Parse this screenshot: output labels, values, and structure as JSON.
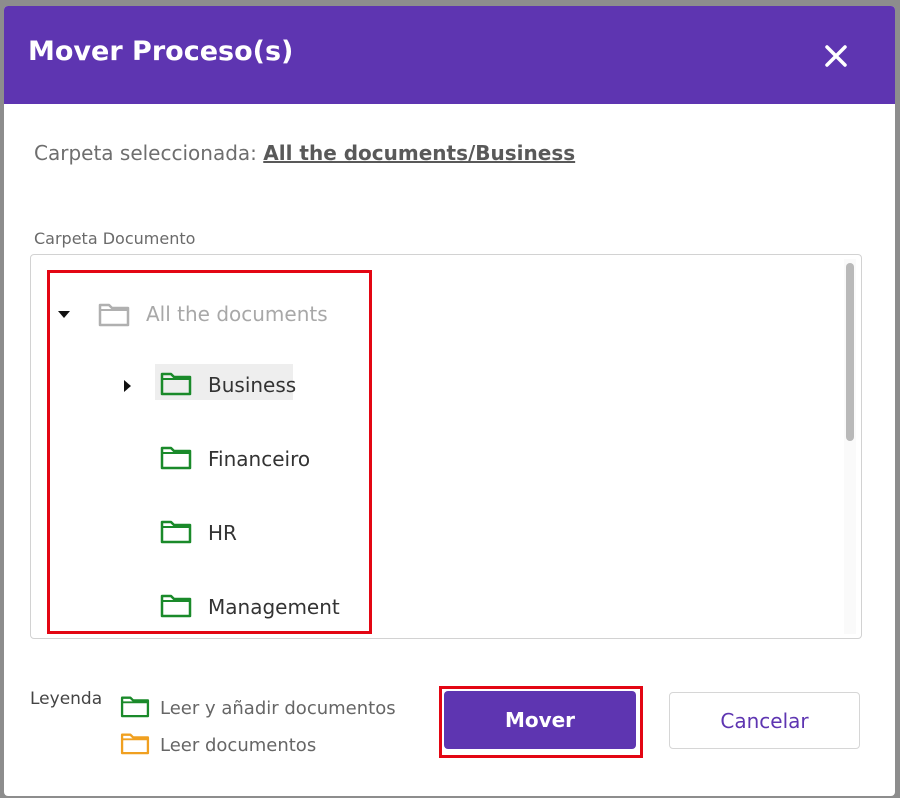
{
  "modal": {
    "title": "Mover Proceso(s)",
    "close_icon": "close-icon"
  },
  "selected": {
    "label": "Carpeta seleccionada:",
    "path": "All the documents/Business"
  },
  "folder_section": {
    "label": "Carpeta Documento"
  },
  "tree": {
    "root": {
      "label": "All the documents",
      "icon": "folder-icon",
      "expanded": true,
      "disabled": true
    },
    "children": [
      {
        "label": "Business",
        "icon": "folder-icon",
        "has_children": true,
        "selected": true
      },
      {
        "label": "Financeiro",
        "icon": "folder-icon"
      },
      {
        "label": "HR",
        "icon": "folder-icon"
      },
      {
        "label": "Management",
        "icon": "folder-icon"
      }
    ]
  },
  "legend": {
    "label": "Leyenda",
    "items": [
      {
        "label": "Leer y añadir documentos",
        "color": "#1a8a2a"
      },
      {
        "label": "Leer documentos",
        "color": "#f0a020"
      }
    ]
  },
  "buttons": {
    "move": "Mover",
    "cancel": "Cancelar"
  },
  "colors": {
    "primary": "#5e35b1",
    "highlight": "#e30613",
    "folder_green": "#1a8a2a",
    "folder_orange": "#f0a020",
    "folder_gray": "#b0b0b0"
  }
}
